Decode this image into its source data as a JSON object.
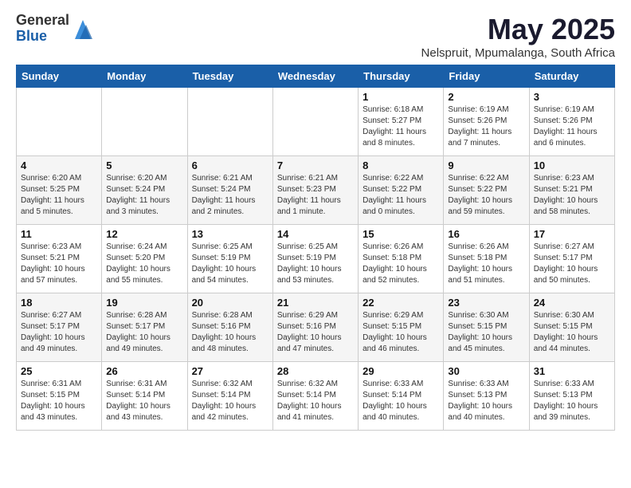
{
  "logo": {
    "general": "General",
    "blue": "Blue"
  },
  "header": {
    "title": "May 2025",
    "subtitle": "Nelspruit, Mpumalanga, South Africa"
  },
  "weekdays": [
    "Sunday",
    "Monday",
    "Tuesday",
    "Wednesday",
    "Thursday",
    "Friday",
    "Saturday"
  ],
  "weeks": [
    [
      {
        "day": "",
        "info": ""
      },
      {
        "day": "",
        "info": ""
      },
      {
        "day": "",
        "info": ""
      },
      {
        "day": "",
        "info": ""
      },
      {
        "day": "1",
        "info": "Sunrise: 6:18 AM\nSunset: 5:27 PM\nDaylight: 11 hours\nand 8 minutes."
      },
      {
        "day": "2",
        "info": "Sunrise: 6:19 AM\nSunset: 5:26 PM\nDaylight: 11 hours\nand 7 minutes."
      },
      {
        "day": "3",
        "info": "Sunrise: 6:19 AM\nSunset: 5:26 PM\nDaylight: 11 hours\nand 6 minutes."
      }
    ],
    [
      {
        "day": "4",
        "info": "Sunrise: 6:20 AM\nSunset: 5:25 PM\nDaylight: 11 hours\nand 5 minutes."
      },
      {
        "day": "5",
        "info": "Sunrise: 6:20 AM\nSunset: 5:24 PM\nDaylight: 11 hours\nand 3 minutes."
      },
      {
        "day": "6",
        "info": "Sunrise: 6:21 AM\nSunset: 5:24 PM\nDaylight: 11 hours\nand 2 minutes."
      },
      {
        "day": "7",
        "info": "Sunrise: 6:21 AM\nSunset: 5:23 PM\nDaylight: 11 hours\nand 1 minute."
      },
      {
        "day": "8",
        "info": "Sunrise: 6:22 AM\nSunset: 5:22 PM\nDaylight: 11 hours\nand 0 minutes."
      },
      {
        "day": "9",
        "info": "Sunrise: 6:22 AM\nSunset: 5:22 PM\nDaylight: 10 hours\nand 59 minutes."
      },
      {
        "day": "10",
        "info": "Sunrise: 6:23 AM\nSunset: 5:21 PM\nDaylight: 10 hours\nand 58 minutes."
      }
    ],
    [
      {
        "day": "11",
        "info": "Sunrise: 6:23 AM\nSunset: 5:21 PM\nDaylight: 10 hours\nand 57 minutes."
      },
      {
        "day": "12",
        "info": "Sunrise: 6:24 AM\nSunset: 5:20 PM\nDaylight: 10 hours\nand 55 minutes."
      },
      {
        "day": "13",
        "info": "Sunrise: 6:25 AM\nSunset: 5:19 PM\nDaylight: 10 hours\nand 54 minutes."
      },
      {
        "day": "14",
        "info": "Sunrise: 6:25 AM\nSunset: 5:19 PM\nDaylight: 10 hours\nand 53 minutes."
      },
      {
        "day": "15",
        "info": "Sunrise: 6:26 AM\nSunset: 5:18 PM\nDaylight: 10 hours\nand 52 minutes."
      },
      {
        "day": "16",
        "info": "Sunrise: 6:26 AM\nSunset: 5:18 PM\nDaylight: 10 hours\nand 51 minutes."
      },
      {
        "day": "17",
        "info": "Sunrise: 6:27 AM\nSunset: 5:17 PM\nDaylight: 10 hours\nand 50 minutes."
      }
    ],
    [
      {
        "day": "18",
        "info": "Sunrise: 6:27 AM\nSunset: 5:17 PM\nDaylight: 10 hours\nand 49 minutes."
      },
      {
        "day": "19",
        "info": "Sunrise: 6:28 AM\nSunset: 5:17 PM\nDaylight: 10 hours\nand 49 minutes."
      },
      {
        "day": "20",
        "info": "Sunrise: 6:28 AM\nSunset: 5:16 PM\nDaylight: 10 hours\nand 48 minutes."
      },
      {
        "day": "21",
        "info": "Sunrise: 6:29 AM\nSunset: 5:16 PM\nDaylight: 10 hours\nand 47 minutes."
      },
      {
        "day": "22",
        "info": "Sunrise: 6:29 AM\nSunset: 5:15 PM\nDaylight: 10 hours\nand 46 minutes."
      },
      {
        "day": "23",
        "info": "Sunrise: 6:30 AM\nSunset: 5:15 PM\nDaylight: 10 hours\nand 45 minutes."
      },
      {
        "day": "24",
        "info": "Sunrise: 6:30 AM\nSunset: 5:15 PM\nDaylight: 10 hours\nand 44 minutes."
      }
    ],
    [
      {
        "day": "25",
        "info": "Sunrise: 6:31 AM\nSunset: 5:15 PM\nDaylight: 10 hours\nand 43 minutes."
      },
      {
        "day": "26",
        "info": "Sunrise: 6:31 AM\nSunset: 5:14 PM\nDaylight: 10 hours\nand 43 minutes."
      },
      {
        "day": "27",
        "info": "Sunrise: 6:32 AM\nSunset: 5:14 PM\nDaylight: 10 hours\nand 42 minutes."
      },
      {
        "day": "28",
        "info": "Sunrise: 6:32 AM\nSunset: 5:14 PM\nDaylight: 10 hours\nand 41 minutes."
      },
      {
        "day": "29",
        "info": "Sunrise: 6:33 AM\nSunset: 5:14 PM\nDaylight: 10 hours\nand 40 minutes."
      },
      {
        "day": "30",
        "info": "Sunrise: 6:33 AM\nSunset: 5:13 PM\nDaylight: 10 hours\nand 40 minutes."
      },
      {
        "day": "31",
        "info": "Sunrise: 6:33 AM\nSunset: 5:13 PM\nDaylight: 10 hours\nand 39 minutes."
      }
    ]
  ]
}
